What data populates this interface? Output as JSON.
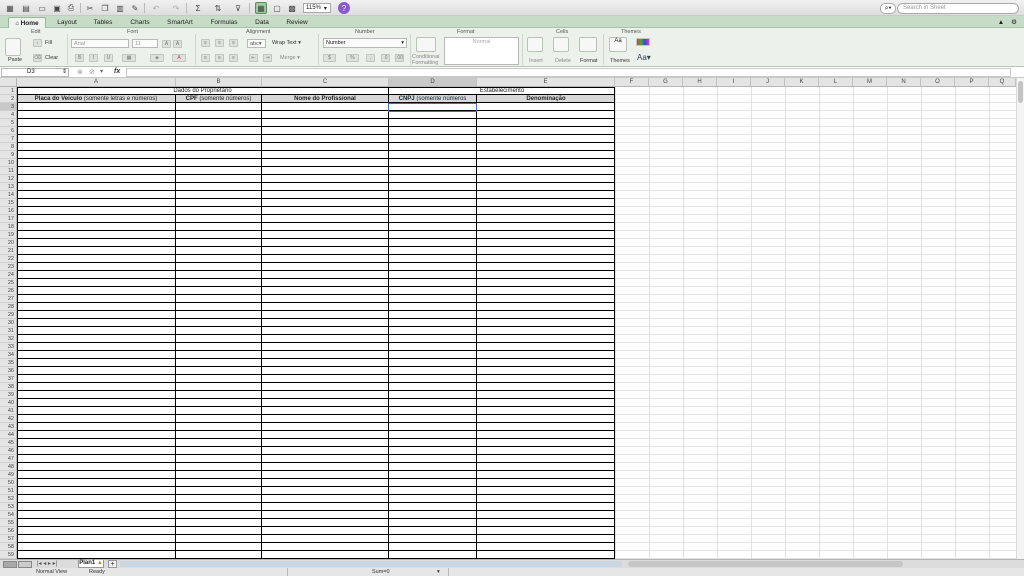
{
  "toolbar": {
    "zoom": "115%",
    "search_placeholder": "Search in Sheet"
  },
  "ribbon_tabs": [
    "Home",
    "Layout",
    "Tables",
    "Charts",
    "SmartArt",
    "Formulas",
    "Data",
    "Review"
  ],
  "ribbon": {
    "groups": {
      "edit": "Edit",
      "font": "Font",
      "alignment": "Alignment",
      "number": "Number",
      "format": "Format",
      "cells": "Cells",
      "themes": "Themes"
    },
    "paste": "Paste",
    "fill": "Fill",
    "clear": "Clear",
    "font_name": "Arial",
    "font_size": "11",
    "wrap_text": "Wrap Text",
    "merge": "Merge",
    "number_format": "Number",
    "conditional_formatting": "Conditional Formatting",
    "style_normal": "Normal",
    "insert": "Insert",
    "delete": "Delete",
    "format": "Format",
    "themes": "Themes",
    "aa": "Aa"
  },
  "formula_bar": {
    "name_box": "D3",
    "fx": "fx",
    "content": ""
  },
  "columns": [
    "A",
    "B",
    "C",
    "D",
    "E",
    "F",
    "G",
    "H",
    "I",
    "J",
    "K",
    "L",
    "M",
    "N",
    "O",
    "P",
    "Q"
  ],
  "rows_count": 59,
  "cells": {
    "r1_owner": "Dados do Proprietário",
    "r1_estab": "Estabelecimento",
    "a2_bold": "Placa do Veículo",
    "a2_rest": " (somente letras e números)",
    "b2_bold": "CPF",
    "b2_rest": " (somente números)",
    "c2": "Nome do Profissional",
    "d2_bold": "CNPJ",
    "d2_rest": " (somente números",
    "e2": "Denominação"
  },
  "sheet_tabs": [
    "Plan1"
  ],
  "status": {
    "view": "Normal View",
    "state": "Ready",
    "sum": "Sum=0"
  }
}
